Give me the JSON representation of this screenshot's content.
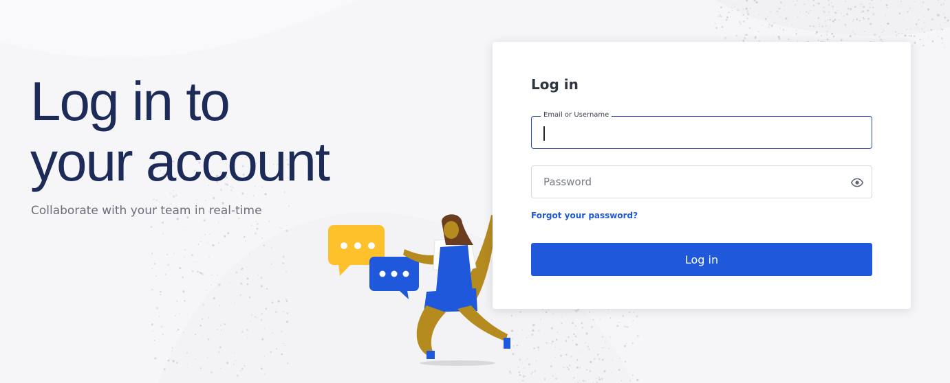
{
  "hero": {
    "title_line1": "Log in to",
    "title_line2": "your account",
    "subtitle": "Collaborate with your team in real-time"
  },
  "login_form": {
    "title": "Log in",
    "email_label": "Email or Username",
    "email_value": "",
    "password_placeholder": "Password",
    "password_toggle_icon": "eye-icon",
    "forgot_password": "Forgot your password?",
    "submit_label": "Log in"
  },
  "colors": {
    "brand_navy": "#1c2b57",
    "primary_button": "#1f58db",
    "link": "#1f58d8",
    "background": "#f6f6f8",
    "chat_bubble_yellow": "#ffc12b",
    "chat_bubble_blue": "#1f58db"
  }
}
